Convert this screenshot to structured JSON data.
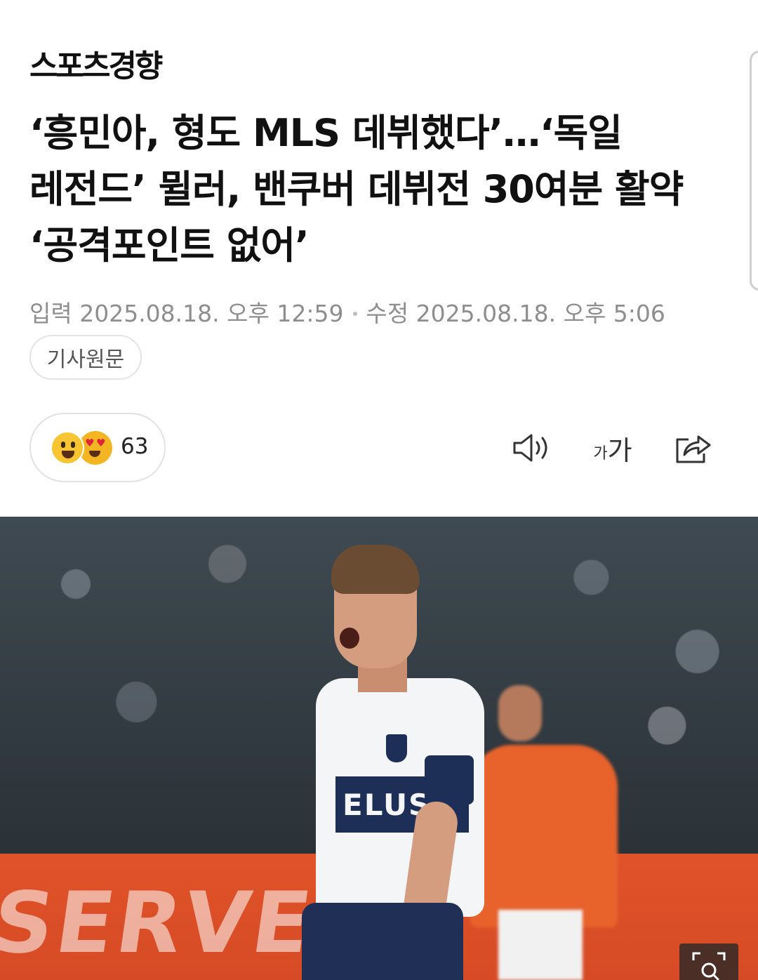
{
  "header": {
    "publisher_logo": "스포츠경향"
  },
  "article": {
    "headline": "‘흥민아, 형도 MLS 데뷔했다’…‘독일 레전드’ 뮐러, 밴쿠버 데뷔전 30여분 활약 ‘공격포인트 없어’",
    "published": "입력 2025.08.18. 오후 12:59",
    "modified": "수정 2025.08.18. 오후 5:06",
    "original_link_label": "기사원문"
  },
  "reactions": {
    "count": "63",
    "emojis": [
      "grinning-face",
      "heart-eyes-face"
    ]
  },
  "toolbar": {
    "speaker_icon": "speaker-icon",
    "font_size_small": "가",
    "font_size_large": "가",
    "share_icon": "share-icon"
  },
  "photo": {
    "jersey_text": "ELUS",
    "board_text": "SERVES"
  },
  "colors": {
    "text_primary": "#111111",
    "text_meta": "#8e8e8e",
    "border": "#e4e4e4",
    "jersey_navy": "#1d2f57",
    "board_orange": "#e0532a"
  }
}
